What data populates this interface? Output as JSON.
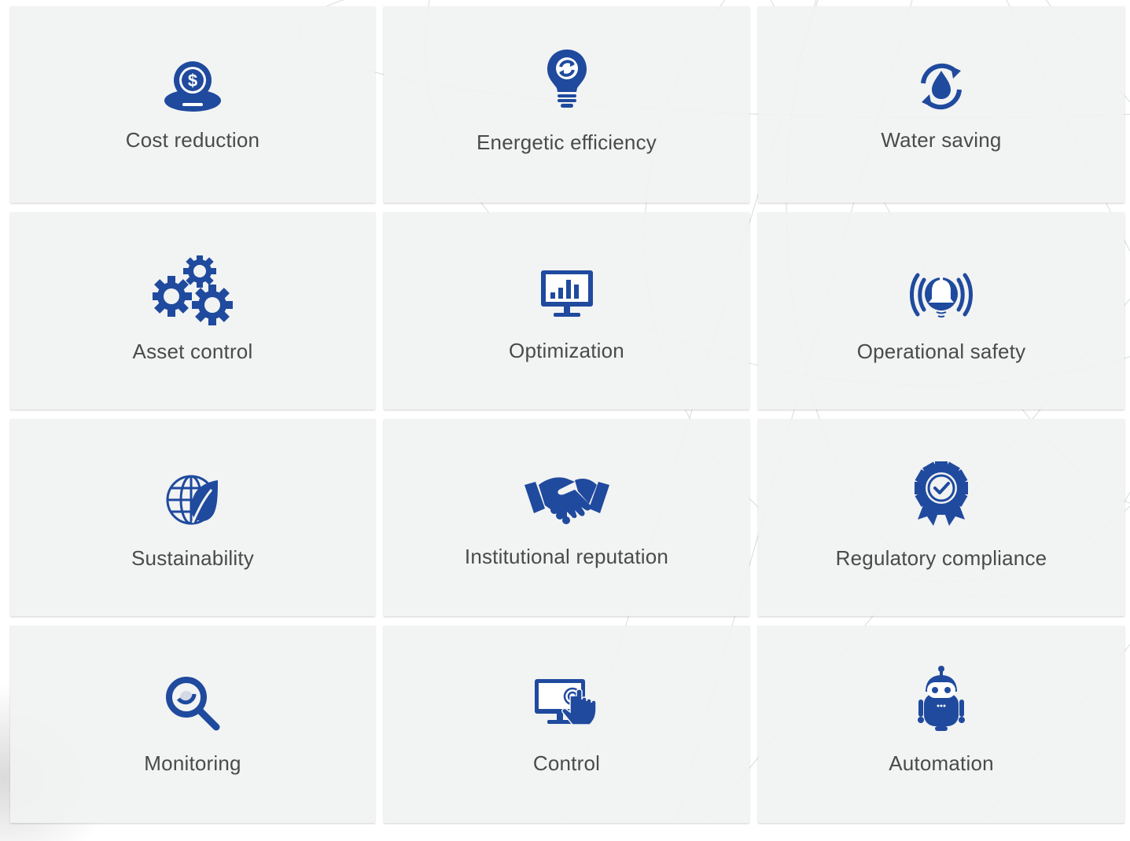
{
  "accent_color": "#1f4a9e",
  "cards": [
    {
      "label": "Cost reduction",
      "icon": "dollar-coin-icon"
    },
    {
      "label": "Energetic efficiency",
      "icon": "lightbulb-icon"
    },
    {
      "label": "Water saving",
      "icon": "water-drop-cycle-icon"
    },
    {
      "label": "Asset control",
      "icon": "gears-icon"
    },
    {
      "label": "Optimization",
      "icon": "monitor-chart-icon"
    },
    {
      "label": "Operational safety",
      "icon": "alarm-bell-icon"
    },
    {
      "label": "Sustainability",
      "icon": "globe-leaf-icon"
    },
    {
      "label": "Institutional reputation",
      "icon": "handshake-icon"
    },
    {
      "label": "Regulatory compliance",
      "icon": "award-badge-icon"
    },
    {
      "label": "Monitoring",
      "icon": "magnifier-icon"
    },
    {
      "label": "Control",
      "icon": "touch-screen-icon"
    },
    {
      "label": "Automation",
      "icon": "robot-icon"
    }
  ]
}
